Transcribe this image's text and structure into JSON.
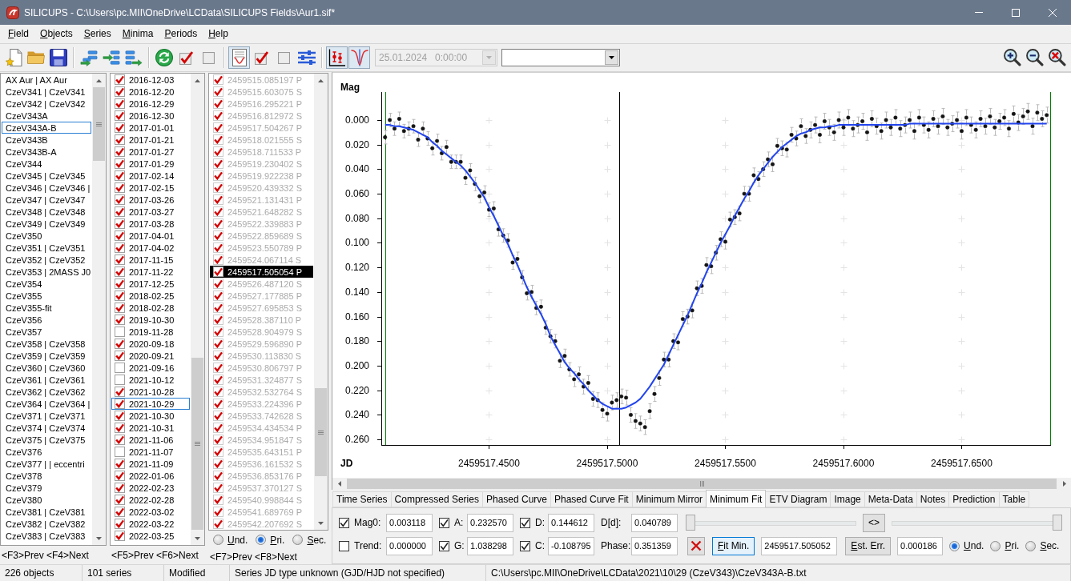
{
  "window": {
    "title": "SILICUPS - C:\\Users\\pc.MII\\OneDrive\\LCData\\SILICUPS Fields\\Aur1.sif*"
  },
  "menu": [
    "Field",
    "Objects",
    "Series",
    "Minima",
    "Periods",
    "Help"
  ],
  "toolbar": {
    "buttons": [
      {
        "pressed": false
      },
      {
        "pressed": false
      },
      {
        "pressed": false
      },
      {
        "pressed": false
      },
      {
        "pressed": false
      },
      {
        "pressed": false
      },
      {
        "pressed": false
      },
      {
        "pressed": false
      },
      {
        "pressed": false
      },
      {
        "pressed": true
      },
      {
        "pressed": false
      },
      {
        "pressed": false
      },
      {
        "pressed": false
      },
      {
        "pressed": true
      },
      {
        "pressed": true
      },
      {
        "pressed": false
      },
      {
        "pressed": false
      },
      {
        "pressed": false
      }
    ],
    "date_field": {
      "value": "25.01.2024   0:00:00",
      "disabled": true
    }
  },
  "objects": {
    "items": [
      {
        "text": "AX Aur | AX Aur",
        "selected": false
      },
      {
        "text": "CzeV341 | CzeV341",
        "selected": false
      },
      {
        "text": "CzeV342 | CzeV342",
        "selected": false
      },
      {
        "text": "CzeV343A",
        "selected": false
      },
      {
        "text": "CzeV343A-B",
        "selected": true
      },
      {
        "text": "CzeV343B",
        "selected": false
      },
      {
        "text": "CzeV343B-A",
        "selected": false
      },
      {
        "text": "CzeV344",
        "selected": false
      },
      {
        "text": "CzeV345 | CzeV345",
        "selected": false
      },
      {
        "text": "CzeV346 | CzeV346 |",
        "selected": false
      },
      {
        "text": "CzeV347 | CzeV347",
        "selected": false
      },
      {
        "text": "CzeV348 | CzeV348",
        "selected": false
      },
      {
        "text": "CzeV349 | CzeV349",
        "selected": false
      },
      {
        "text": "CzeV350",
        "selected": false
      },
      {
        "text": "CzeV351 | CzeV351",
        "selected": false
      },
      {
        "text": "CzeV352 | CzeV352",
        "selected": false
      },
      {
        "text": "CzeV353 | 2MASS J0",
        "selected": false
      },
      {
        "text": "CzeV354",
        "selected": false
      },
      {
        "text": "CzeV355",
        "selected": false
      },
      {
        "text": "CzeV355-fit",
        "selected": false
      },
      {
        "text": "CzeV356",
        "selected": false
      },
      {
        "text": "CzeV357",
        "selected": false
      },
      {
        "text": "CzeV358 | CzeV358",
        "selected": false
      },
      {
        "text": "CzeV359 | CzeV359",
        "selected": false
      },
      {
        "text": "CzeV360 | CzeV360",
        "selected": false
      },
      {
        "text": "CzeV361 | CzeV361",
        "selected": false
      },
      {
        "text": "CzeV362 | CzeV362",
        "selected": false
      },
      {
        "text": "CzeV364 | CzeV364 |",
        "selected": false
      },
      {
        "text": "CzeV371 | CzeV371",
        "selected": false
      },
      {
        "text": "CzeV374 | CzeV374",
        "selected": false
      },
      {
        "text": "CzeV375 | CzeV375",
        "selected": false
      },
      {
        "text": "CzeV376",
        "selected": false
      },
      {
        "text": "CzeV377 | | eccentri",
        "selected": false
      },
      {
        "text": "CzeV378",
        "selected": false
      },
      {
        "text": "CzeV379",
        "selected": false
      },
      {
        "text": "CzeV380",
        "selected": false
      },
      {
        "text": "CzeV381 | CzeV381",
        "selected": false
      },
      {
        "text": "CzeV382 | CzeV382",
        "selected": false
      },
      {
        "text": "CzeV383 | CzeV383",
        "selected": false
      }
    ],
    "footer": "<F3>Prev <F4>Next"
  },
  "series": {
    "items": [
      {
        "text": "2016-12-03",
        "checked": true,
        "selected": false
      },
      {
        "text": "2016-12-20",
        "checked": true,
        "selected": false
      },
      {
        "text": "2016-12-29",
        "checked": true,
        "selected": false
      },
      {
        "text": "2016-12-30",
        "checked": true,
        "selected": false
      },
      {
        "text": "2017-01-01",
        "checked": true,
        "selected": false
      },
      {
        "text": "2017-01-21",
        "checked": true,
        "selected": false
      },
      {
        "text": "2017-01-27",
        "checked": true,
        "selected": false
      },
      {
        "text": "2017-01-29",
        "checked": true,
        "selected": false
      },
      {
        "text": "2017-02-14",
        "checked": true,
        "selected": false
      },
      {
        "text": "2017-02-15",
        "checked": true,
        "selected": false
      },
      {
        "text": "2017-03-26",
        "checked": true,
        "selected": false
      },
      {
        "text": "2017-03-27",
        "checked": true,
        "selected": false
      },
      {
        "text": "2017-03-28",
        "checked": true,
        "selected": false
      },
      {
        "text": "2017-04-01",
        "checked": true,
        "selected": false
      },
      {
        "text": "2017-04-02",
        "checked": true,
        "selected": false
      },
      {
        "text": "2017-11-15",
        "checked": true,
        "selected": false
      },
      {
        "text": "2017-11-22",
        "checked": true,
        "selected": false
      },
      {
        "text": "2017-12-25",
        "checked": true,
        "selected": false
      },
      {
        "text": "2018-02-25",
        "checked": true,
        "selected": false
      },
      {
        "text": "2018-02-28",
        "checked": true,
        "selected": false
      },
      {
        "text": "2019-10-30",
        "checked": true,
        "selected": false
      },
      {
        "text": "2019-11-28",
        "checked": false,
        "selected": false
      },
      {
        "text": "2020-09-18",
        "checked": true,
        "selected": false
      },
      {
        "text": "2020-09-21",
        "checked": true,
        "selected": false
      },
      {
        "text": "2021-09-16",
        "checked": false,
        "selected": false
      },
      {
        "text": "2021-10-12",
        "checked": false,
        "selected": false
      },
      {
        "text": "2021-10-28",
        "checked": true,
        "selected": false
      },
      {
        "text": "2021-10-29",
        "checked": true,
        "selected": true
      },
      {
        "text": "2021-10-30",
        "checked": true,
        "selected": false
      },
      {
        "text": "2021-10-31",
        "checked": true,
        "selected": false
      },
      {
        "text": "2021-11-06",
        "checked": true,
        "selected": false
      },
      {
        "text": "2021-11-07",
        "checked": false,
        "selected": false
      },
      {
        "text": "2021-11-09",
        "checked": true,
        "selected": false
      },
      {
        "text": "2022-01-06",
        "checked": true,
        "selected": false
      },
      {
        "text": "2022-02-23",
        "checked": true,
        "selected": false
      },
      {
        "text": "2022-02-28",
        "checked": true,
        "selected": false
      },
      {
        "text": "2022-03-02",
        "checked": true,
        "selected": false
      },
      {
        "text": "2022-03-22",
        "checked": true,
        "selected": false
      },
      {
        "text": "2022-03-25",
        "checked": true,
        "selected": false
      }
    ],
    "footer": "<F5>Prev <F6>Next"
  },
  "minima": {
    "items": [
      {
        "text": "2459515.085197 P",
        "checked": true,
        "disabled": true,
        "selected": false
      },
      {
        "text": "2459515.603075 S",
        "checked": true,
        "disabled": true,
        "selected": false
      },
      {
        "text": "2459516.295221 P",
        "checked": true,
        "disabled": true,
        "selected": false
      },
      {
        "text": "2459516.812972 S",
        "checked": true,
        "disabled": true,
        "selected": false
      },
      {
        "text": "2459517.504267 P",
        "checked": true,
        "disabled": true,
        "selected": false
      },
      {
        "text": "2459518.021555 S",
        "checked": true,
        "disabled": true,
        "selected": false
      },
      {
        "text": "2459518.711533 P",
        "checked": true,
        "disabled": true,
        "selected": false
      },
      {
        "text": "2459519.230402 S",
        "checked": true,
        "disabled": true,
        "selected": false
      },
      {
        "text": "2459519.922238 P",
        "checked": true,
        "disabled": true,
        "selected": false
      },
      {
        "text": "2459520.439332 S",
        "checked": true,
        "disabled": true,
        "selected": false
      },
      {
        "text": "2459521.131431 P",
        "checked": true,
        "disabled": true,
        "selected": false
      },
      {
        "text": "2459521.648282 S",
        "checked": true,
        "disabled": true,
        "selected": false
      },
      {
        "text": "2459522.339883 P",
        "checked": true,
        "disabled": true,
        "selected": false
      },
      {
        "text": "2459522.859689 S",
        "checked": true,
        "disabled": true,
        "selected": false
      },
      {
        "text": "2459523.550789 P",
        "checked": true,
        "disabled": true,
        "selected": false
      },
      {
        "text": "2459524.067114 S",
        "checked": true,
        "disabled": true,
        "selected": false
      },
      {
        "text": "2459517.505054 P",
        "checked": true,
        "disabled": false,
        "selected": true
      },
      {
        "text": "2459526.487120 S",
        "checked": true,
        "disabled": true,
        "selected": false
      },
      {
        "text": "2459527.177885 P",
        "checked": true,
        "disabled": true,
        "selected": false
      },
      {
        "text": "2459527.695853 S",
        "checked": true,
        "disabled": true,
        "selected": false
      },
      {
        "text": "2459528.387110 P",
        "checked": true,
        "disabled": true,
        "selected": false
      },
      {
        "text": "2459528.904979 S",
        "checked": true,
        "disabled": true,
        "selected": false
      },
      {
        "text": "2459529.596890 P",
        "checked": true,
        "disabled": true,
        "selected": false
      },
      {
        "text": "2459530.113830 S",
        "checked": true,
        "disabled": true,
        "selected": false
      },
      {
        "text": "2459530.806797 P",
        "checked": true,
        "disabled": true,
        "selected": false
      },
      {
        "text": "2459531.324877 S",
        "checked": true,
        "disabled": true,
        "selected": false
      },
      {
        "text": "2459532.532764 S",
        "checked": true,
        "disabled": true,
        "selected": false
      },
      {
        "text": "2459533.224396 P",
        "checked": true,
        "disabled": true,
        "selected": false
      },
      {
        "text": "2459533.742628 S",
        "checked": true,
        "disabled": true,
        "selected": false
      },
      {
        "text": "2459534.434534 P",
        "checked": true,
        "disabled": true,
        "selected": false
      },
      {
        "text": "2459534.951847 S",
        "checked": true,
        "disabled": true,
        "selected": false
      },
      {
        "text": "2459535.643151 P",
        "checked": true,
        "disabled": true,
        "selected": false
      },
      {
        "text": "2459536.161532 S",
        "checked": true,
        "disabled": true,
        "selected": false
      },
      {
        "text": "2459536.853176 P",
        "checked": true,
        "disabled": true,
        "selected": false
      },
      {
        "text": "2459537.370127 S",
        "checked": true,
        "disabled": true,
        "selected": false
      },
      {
        "text": "2459540.998844 S",
        "checked": true,
        "disabled": true,
        "selected": false
      },
      {
        "text": "2459541.689769 P",
        "checked": true,
        "disabled": true,
        "selected": false
      },
      {
        "text": "2459542.207692 S",
        "checked": true,
        "disabled": true,
        "selected": false
      }
    ],
    "type_options": [
      {
        "label": "Und.",
        "selected": false
      },
      {
        "label": "Pri.",
        "selected": true
      },
      {
        "label": "Sec.",
        "selected": false
      }
    ],
    "footer": "<F7>Prev <F8>Next"
  },
  "chart": {
    "chart_data": {
      "type": "scatter",
      "xlabel": "JD",
      "ylabel": "Mag",
      "x": [
        2459517.406,
        2459517.408,
        2459517.41,
        2459517.412,
        2459517.414,
        2459517.416,
        2459517.418,
        2459517.42,
        2459517.422,
        2459517.424,
        2459517.426,
        2459517.428,
        2459517.43,
        2459517.432,
        2459517.434,
        2459517.436,
        2459517.438,
        2459517.44,
        2459517.442,
        2459517.444,
        2459517.446,
        2459517.448,
        2459517.45,
        2459517.452,
        2459517.454,
        2459517.456,
        2459517.458,
        2459517.46,
        2459517.462,
        2459517.464,
        2459517.466,
        2459517.468,
        2459517.47,
        2459517.472,
        2459517.474,
        2459517.476,
        2459517.478,
        2459517.48,
        2459517.482,
        2459517.484,
        2459517.486,
        2459517.488,
        2459517.49,
        2459517.492,
        2459517.494,
        2459517.496,
        2459517.498,
        2459517.5,
        2459517.502,
        2459517.504,
        2459517.506,
        2459517.508,
        2459517.51,
        2459517.512,
        2459517.514,
        2459517.516,
        2459517.518,
        2459517.52,
        2459517.522,
        2459517.524,
        2459517.526,
        2459517.528,
        2459517.53,
        2459517.532,
        2459517.534,
        2459517.536,
        2459517.538,
        2459517.54,
        2459517.542,
        2459517.544,
        2459517.546,
        2459517.548,
        2459517.55,
        2459517.552,
        2459517.554,
        2459517.556,
        2459517.558,
        2459517.56,
        2459517.562,
        2459517.564,
        2459517.566,
        2459517.568,
        2459517.57,
        2459517.572,
        2459517.574,
        2459517.576,
        2459517.578,
        2459517.58,
        2459517.582,
        2459517.584,
        2459517.586,
        2459517.588,
        2459517.59,
        2459517.592,
        2459517.594,
        2459517.596,
        2459517.598,
        2459517.6,
        2459517.602,
        2459517.604,
        2459517.606,
        2459517.608,
        2459517.61,
        2459517.612,
        2459517.614,
        2459517.616,
        2459517.618,
        2459517.62,
        2459517.622,
        2459517.624,
        2459517.626,
        2459517.628,
        2459517.63,
        2459517.632,
        2459517.634,
        2459517.636,
        2459517.638,
        2459517.64,
        2459517.642,
        2459517.644,
        2459517.646,
        2459517.648,
        2459517.65,
        2459517.652,
        2459517.654,
        2459517.656,
        2459517.658,
        2459517.66,
        2459517.662,
        2459517.664,
        2459517.666,
        2459517.668,
        2459517.67,
        2459517.672,
        2459517.674,
        2459517.676,
        2459517.678,
        2459517.68,
        2459517.682,
        2459517.684,
        2459517.686
      ],
      "series": [
        {
          "type": "scatter",
          "color": "#141414",
          "values": [
            0.014,
            0.0,
            0.007,
            -0.001,
            0.009,
            0.007,
            0.005,
            0.016,
            0.007,
            0.015,
            0.023,
            0.017,
            0.027,
            0.022,
            0.034,
            0.034,
            0.034,
            0.047,
            0.041,
            0.052,
            0.062,
            0.059,
            0.073,
            0.072,
            0.089,
            0.094,
            0.098,
            0.116,
            0.113,
            0.128,
            0.141,
            0.14,
            0.153,
            0.152,
            0.169,
            0.176,
            0.18,
            0.196,
            0.192,
            0.203,
            0.211,
            0.207,
            0.217,
            0.214,
            0.227,
            0.228,
            0.236,
            0.239,
            0.23,
            0.228,
            0.225,
            0.226,
            0.24,
            0.245,
            0.247,
            0.25,
            0.237,
            0.223,
            0.21,
            0.195,
            0.195,
            0.18,
            0.181,
            0.162,
            0.16,
            0.155,
            0.137,
            0.135,
            0.118,
            0.119,
            0.108,
            0.097,
            0.099,
            0.081,
            0.079,
            0.076,
            0.06,
            0.06,
            0.045,
            0.048,
            0.04,
            0.032,
            0.036,
            0.021,
            0.023,
            0.024,
            0.012,
            0.015,
            0.005,
            0.013,
            0.008,
            0.004,
            0.012,
            0.001,
            0.006,
            0.01,
            0.0,
            0.006,
            -0.002,
            0.007,
            0.004,
            0.001,
            0.01,
            -0.001,
            0.005,
            0.009,
            0.0,
            0.006,
            -0.002,
            0.007,
            0.004,
            0.0,
            0.009,
            -0.002,
            0.004,
            0.008,
            -0.001,
            0.005,
            -0.003,
            0.006,
            0.003,
            0.0,
            0.009,
            -0.002,
            0.004,
            0.008,
            -0.001,
            0.005,
            -0.003,
            0.006,
            0.001,
            -0.002,
            0.007,
            -0.005,
            0.002,
            -0.003,
            -0.007,
            0.005,
            -0.006,
            -0.001,
            -0.004
          ],
          "errors": [
            0.0055,
            0.0055,
            0.0055,
            0.0055,
            0.0055,
            0.0055,
            0.0055,
            0.0055,
            0.0055,
            0.0055,
            0.0055,
            0.0055,
            0.0055,
            0.0055,
            0.0055,
            0.0055,
            0.0055,
            0.0055,
            0.0055,
            0.0055,
            0.0055,
            0.0055,
            0.0055,
            0.0055,
            0.0055,
            0.0055,
            0.0055,
            0.0055,
            0.0055,
            0.0055,
            0.0055,
            0.0055,
            0.0055,
            0.0055,
            0.0055,
            0.0055,
            0.0055,
            0.0055,
            0.0055,
            0.0055,
            0.006,
            0.006,
            0.006,
            0.006,
            0.006,
            0.006,
            0.006,
            0.006,
            0.006,
            0.006,
            0.006,
            0.006,
            0.006,
            0.006,
            0.006,
            0.006,
            0.006,
            0.006,
            0.006,
            0.006,
            0.006,
            0.006,
            0.006,
            0.006,
            0.006,
            0.006,
            0.006,
            0.006,
            0.006,
            0.006,
            0.006,
            0.006,
            0.006,
            0.006,
            0.006,
            0.006,
            0.006,
            0.006,
            0.006,
            0.006,
            0.006,
            0.006,
            0.006,
            0.006,
            0.006,
            0.006,
            0.006,
            0.006,
            0.006,
            0.006,
            0.0065,
            0.0065,
            0.0065,
            0.0065,
            0.0065,
            0.0065,
            0.0065,
            0.0065,
            0.0065,
            0.0065,
            0.0065,
            0.0065,
            0.0065,
            0.0065,
            0.0065,
            0.0065,
            0.0065,
            0.0065,
            0.0065,
            0.0065,
            0.0065,
            0.0065,
            0.0065,
            0.0065,
            0.0065,
            0.0065,
            0.0065,
            0.0065,
            0.0065,
            0.0065,
            0.0065,
            0.0065,
            0.0065,
            0.0065,
            0.0065,
            0.0065,
            0.0065,
            0.0065,
            0.0065,
            0.0065,
            0.0065,
            0.0065,
            0.0065,
            0.0065,
            0.0065,
            0.0065,
            0.0065,
            0.0065,
            0.0065,
            0.0065,
            0.0065
          ]
        },
        {
          "type": "line",
          "color": "#2244ee",
          "values": [
            0.004,
            0.004,
            0.005,
            0.005,
            0.006,
            0.007,
            0.008,
            0.01,
            0.012,
            0.014,
            0.018,
            0.021,
            0.025,
            0.028,
            0.031,
            0.034,
            0.037,
            0.041,
            0.046,
            0.051,
            0.057,
            0.063,
            0.071,
            0.078,
            0.086,
            0.094,
            0.101,
            0.11,
            0.118,
            0.127,
            0.136,
            0.144,
            0.151,
            0.158,
            0.166,
            0.176,
            0.183,
            0.19,
            0.197,
            0.202,
            0.206,
            0.211,
            0.215,
            0.22,
            0.224,
            0.228,
            0.231,
            0.233,
            0.235,
            0.235,
            0.235,
            0.234,
            0.232,
            0.23,
            0.227,
            0.222,
            0.217,
            0.211,
            0.205,
            0.199,
            0.191,
            0.183,
            0.175,
            0.167,
            0.159,
            0.15,
            0.141,
            0.133,
            0.124,
            0.116,
            0.108,
            0.1,
            0.093,
            0.086,
            0.078,
            0.071,
            0.064,
            0.058,
            0.051,
            0.045,
            0.04,
            0.035,
            0.03,
            0.026,
            0.022,
            0.019,
            0.016,
            0.013,
            0.011,
            0.01,
            0.008,
            0.007,
            0.006,
            0.006,
            0.005,
            0.005,
            0.004,
            0.004,
            0.004,
            0.004,
            0.004,
            0.004,
            0.004,
            0.004,
            0.004,
            0.004,
            0.004,
            0.004,
            0.004,
            0.004,
            0.004,
            0.003,
            0.003,
            0.003,
            0.003,
            0.003,
            0.003,
            0.003,
            0.003,
            0.003,
            0.003,
            0.003,
            0.003,
            0.003,
            0.003,
            0.003,
            0.003,
            0.003,
            0.003,
            0.003,
            0.003,
            0.003,
            0.003,
            0.003,
            0.003,
            0.003,
            0.003,
            0.003,
            0.003,
            0.003,
            0.003
          ]
        }
      ],
      "xlim": [
        2459517.40441,
        2459517.6878
      ],
      "ylim": [
        0.2645,
        -0.0228
      ],
      "xticks": [
        {
          "value": 2459517.45,
          "label": "2459517.4500"
        },
        {
          "value": 2459517.5,
          "label": "2459517.5000"
        },
        {
          "value": 2459517.55,
          "label": "2459517.5500"
        },
        {
          "value": 2459517.6,
          "label": "2459517.6000"
        },
        {
          "value": 2459517.65,
          "label": "2459517.6500"
        }
      ],
      "yticks": [
        {
          "value": 0,
          "label": "0.000"
        },
        {
          "value": 0.02,
          "label": "0.020"
        },
        {
          "value": 0.04,
          "label": "0.040"
        },
        {
          "value": 0.06,
          "label": "0.060"
        },
        {
          "value": 0.08,
          "label": "0.080"
        },
        {
          "value": 0.1,
          "label": "0.100"
        },
        {
          "value": 0.12,
          "label": "0.120"
        },
        {
          "value": 0.14,
          "label": "0.140"
        },
        {
          "value": 0.16,
          "label": "0.160"
        },
        {
          "value": 0.18,
          "label": "0.180"
        },
        {
          "value": 0.2,
          "label": "0.200"
        },
        {
          "value": 0.22,
          "label": "0.220"
        },
        {
          "value": 0.24,
          "label": "0.240"
        },
        {
          "value": 0.26,
          "label": "0.260"
        }
      ],
      "ref_lines": [
        {
          "axis": "x",
          "value": 2459517.4061,
          "color": "#008000"
        },
        {
          "axis": "x",
          "value": 2459517.50508,
          "color": "#000000"
        },
        {
          "axis": "x",
          "value": 2459517.6875,
          "color": "#008000"
        }
      ]
    }
  },
  "tabs": [
    {
      "label": "Time Series",
      "selected": false
    },
    {
      "label": "Compressed Series",
      "selected": false
    },
    {
      "label": "Phased Curve",
      "selected": false
    },
    {
      "label": "Phased Curve Fit",
      "selected": false
    },
    {
      "label": "Minimum Mirror",
      "selected": false
    },
    {
      "label": "Minimum Fit",
      "selected": true
    },
    {
      "label": "ETV Diagram",
      "selected": false
    },
    {
      "label": "Image",
      "selected": false
    },
    {
      "label": "Meta-Data",
      "selected": false
    },
    {
      "label": "Notes",
      "selected": false
    },
    {
      "label": "Prediction",
      "selected": false
    },
    {
      "label": "Table",
      "selected": false
    }
  ],
  "fit_panel": {
    "rows": [
      [
        {
          "kind": "toggle",
          "label": "Mag0:",
          "checked": true,
          "value": "0.003118"
        },
        {
          "kind": "toggle",
          "label": "A:",
          "checked": true,
          "value": "0.232570"
        },
        {
          "kind": "toggle",
          "label": "D:",
          "checked": true,
          "value": "0.144612"
        },
        {
          "kind": "plain",
          "label": "D[d]:",
          "value": "0.040789"
        }
      ],
      [
        {
          "kind": "toggle",
          "label": "Trend:",
          "checked": false,
          "value": "0.000000"
        },
        {
          "kind": "toggle",
          "label": "G:",
          "checked": true,
          "value": "1.038298"
        },
        {
          "kind": "toggle",
          "label": "C:",
          "checked": true,
          "value": "-0.108795"
        },
        {
          "kind": "plain",
          "label": "Phase:",
          "value": "0.351359"
        }
      ]
    ],
    "sliders": [
      {
        "level": 0
      },
      {
        "level": 1
      }
    ],
    "swap_button": "<>",
    "fit_button": {
      "label": "Fit Min.",
      "focused": true
    },
    "minimum_time": "2459517.505052",
    "error_button": "Est. Err.",
    "error_value": "0.000186",
    "type_options": [
      {
        "label": "Und.",
        "selected": true
      },
      {
        "label": "Pri.",
        "selected": false
      },
      {
        "label": "Sec.",
        "selected": false
      }
    ]
  },
  "status_bar": [
    "226 objects",
    "101 series",
    "Modified",
    "Series JD type unknown (GJD/HJD not specified)",
    "C:\\Users\\pc.MII\\OneDrive\\LCData\\2021\\10\\29 (CzeV343)\\CzeV343A-B.txt"
  ]
}
